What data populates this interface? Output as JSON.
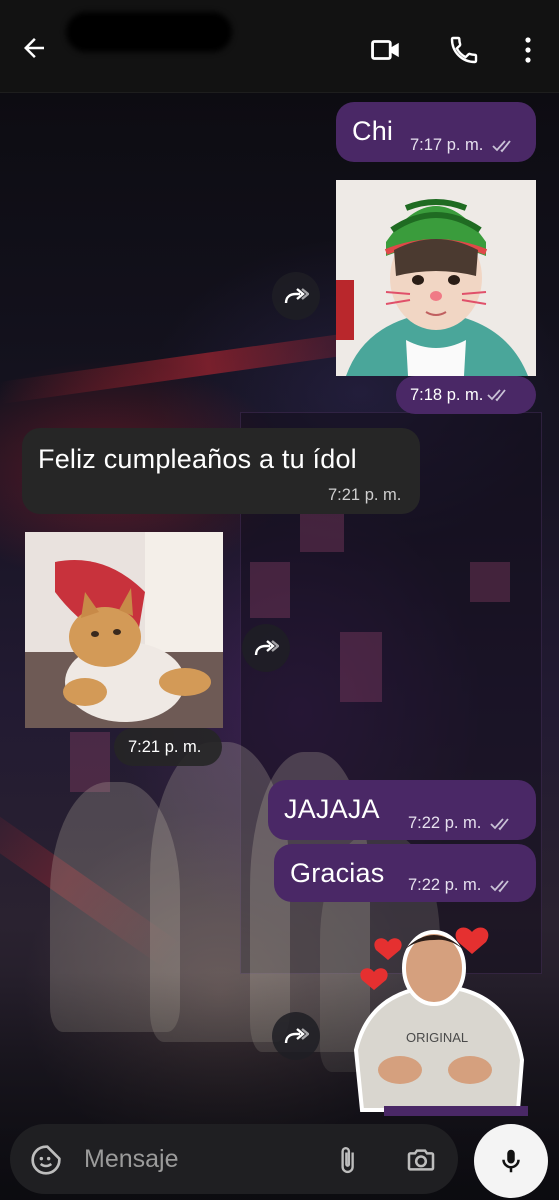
{
  "header": {
    "back_icon": "arrow-left-icon",
    "contact_name": "",
    "video_icon": "video-camera-icon",
    "call_icon": "phone-icon",
    "more_icon": "dots-vertical-icon"
  },
  "messages": [
    {
      "type": "text",
      "direction": "outgoing",
      "text": "Chi",
      "time": "7:17 p. m.",
      "status": "read"
    },
    {
      "type": "image",
      "direction": "outgoing",
      "image": "boy-with-watermelon-helmet-filter",
      "time": "7:18 p. m.",
      "status": "read"
    },
    {
      "type": "text",
      "direction": "incoming",
      "text": "Feliz cumpleaños a tu ídol",
      "time": "7:21 p. m."
    },
    {
      "type": "image",
      "direction": "incoming",
      "image": "orange-cat",
      "time": "7:21 p. m."
    },
    {
      "type": "text",
      "direction": "outgoing",
      "text": "JAJAJA",
      "time": "7:22 p. m.",
      "status": "read"
    },
    {
      "type": "text",
      "direction": "outgoing",
      "text": "Gracias",
      "time": "7:22 p. m.",
      "status": "read"
    },
    {
      "type": "sticker",
      "direction": "outgoing",
      "image": "man-with-hearts-sticker"
    }
  ],
  "composer": {
    "placeholder": "Mensaje",
    "emoji_icon": "sticker-smiley-icon",
    "attach_icon": "paperclip-icon",
    "camera_icon": "camera-icon",
    "mic_icon": "microphone-icon"
  },
  "colors": {
    "outgoing_bubble": "#4a2866",
    "incoming_bubble": "#262626",
    "header": "#121212",
    "read_ticks": "#c9c2d6"
  }
}
